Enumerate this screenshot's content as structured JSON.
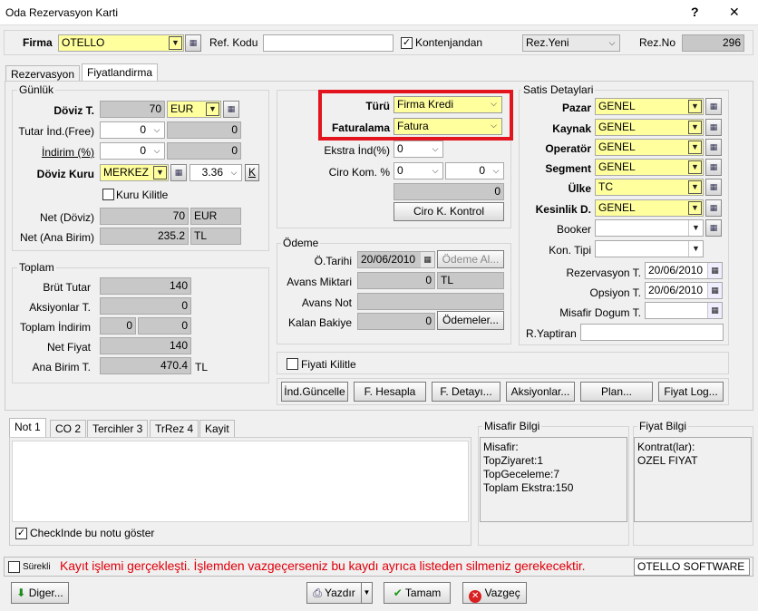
{
  "window": {
    "title": "Oda Rezervasyon Karti",
    "help": "?",
    "close": "✕"
  },
  "top": {
    "firma_label": "Firma",
    "firma_value": "OTELLO",
    "ref_label": "Ref. Kodu",
    "ref_value": "",
    "kontenjan_label": "Kontenjandan",
    "kontenjan_checked": "✓",
    "status_value": "Rez.Yeni",
    "rezno_label": "Rez.No",
    "rezno_value": "296"
  },
  "tabs": {
    "tab1": "Rezervasyon",
    "tab2": "Fiyatlandirma"
  },
  "gunluk": {
    "title": "Günlük",
    "doviz_t_label": "Döviz T.",
    "doviz_t_value": "70",
    "doviz_t_cur": "EUR",
    "tutar_label": "Tutar İnd.(Free)",
    "tutar_value": "0",
    "tutar_result": "0",
    "indirim_label": "İndirim (%)",
    "indirim_value": "0",
    "indirim_result": "0",
    "kuru_label": "Döviz Kuru",
    "kuru_source": "MERKEZ",
    "kuru_value": "3.36",
    "kuru_k": "K",
    "kilitle_label": "Kuru Kilitle",
    "net_doviz_label": "Net (Döviz)",
    "net_doviz_value": "70",
    "net_doviz_cur": "EUR",
    "net_ana_label": "Net (Ana Birim)",
    "net_ana_value": "235.2",
    "net_ana_cur": "TL"
  },
  "toplam": {
    "title": "Toplam",
    "brut_label": "Brüt Tutar",
    "brut_value": "140",
    "aksiyon_label": "Aksiyonlar T.",
    "aksiyon_value": "0",
    "indirim_label": "Toplam İndirim",
    "indirim_a": "0",
    "indirim_b": "0",
    "net_label": "Net Fiyat",
    "net_value": "140",
    "ana_label": "Ana Birim T.",
    "ana_value": "470.4",
    "ana_cur": "TL"
  },
  "turu": {
    "turu_label": "Türü",
    "turu_value": "Firma Kredi",
    "fatura_label": "Faturalama",
    "fatura_value": "Fatura",
    "ekstra_label": "Ekstra İnd(%)",
    "ekstra_value": "0",
    "ciro_label": "Ciro Kom. %",
    "ciro_a": "0",
    "ciro_b": "0",
    "ciro_total": "0",
    "kontrol_button": "Ciro K. Kontrol"
  },
  "odeme": {
    "title": "Ödeme",
    "tarih_label": "Ö.Tarihi",
    "tarih_value": "20/06/2010",
    "odeme_al_button": "Ödeme Al...",
    "avans_label": "Avans Miktari",
    "avans_value": "0",
    "avans_cur": "TL",
    "avans_not_label": "Avans Not",
    "avans_not_value": "",
    "kalan_label": "Kalan Bakiye",
    "kalan_value": "0",
    "odemeler_button": "Ödemeler..."
  },
  "satis": {
    "title": "Satis Detaylari",
    "pazar_label": "Pazar",
    "pazar_value": "GENEL",
    "kaynak_label": "Kaynak",
    "kaynak_value": "GENEL",
    "operator_label": "Operatör",
    "operator_value": "GENEL",
    "segment_label": "Segment",
    "segment_value": "GENEL",
    "ulke_label": "Ülke",
    "ulke_value": "TC",
    "kesinlik_label": "Kesinlik D.",
    "kesinlik_value": "GENEL",
    "booker_label": "Booker",
    "booker_value": "",
    "kontipi_label": "Kon. Tipi",
    "kontipi_value": "",
    "rez_t_label": "Rezervasyon T.",
    "rez_t_value": "20/06/2010",
    "opsiyon_label": "Opsiyon T.",
    "opsiyon_value": "20/06/2010",
    "dogum_label": "Misafir Dogum T.",
    "dogum_value": "",
    "yaptiran_label": "R.Yaptiran",
    "yaptiran_value": ""
  },
  "fiyat_kilitle": "Fiyati Kilitle",
  "actions": {
    "ind_guncelle": "İnd.Güncelle",
    "f_hesapla": "F. Hesapla",
    "f_detayi": "F. Detayı...",
    "aksiyonlar": "Aksiyonlar...",
    "plan": "Plan...",
    "fiyat_log": "Fiyat Log..."
  },
  "notes": {
    "tabs": [
      "Not 1",
      "CO 2",
      "Tercihler 3",
      "TrRez 4",
      "Kayit"
    ],
    "text": "",
    "checkbox_label": "CheckInde bu notu göster",
    "checkbox_mark": "✓"
  },
  "misafir": {
    "title": "Misafir Bilgi",
    "lines": [
      "Misafir:",
      "TopZiyaret:1",
      "TopGeceleme:7",
      "Toplam Ekstra:150"
    ]
  },
  "fiyatbilgi": {
    "title": "Fiyat Bilgi",
    "lines": [
      "Kontrat(lar):",
      "OZEL FIYAT"
    ]
  },
  "status": {
    "surekli_label": "Sürekli",
    "message": "Kayıt işlemi gerçekleşti. İşlemden vazgeçerseniz bu kaydı ayrıca listeden silmeniz gerekecektir.",
    "company": "OTELLO SOFTWARE"
  },
  "bottom": {
    "diger": "Diger...",
    "yazdir": "Yazdır",
    "tamam": "Tamam",
    "vazgec": "Vazgeç"
  },
  "colors": {
    "highlight_border": "#e3141e",
    "field_yellow": "#ffff9e",
    "field_gray": "#c8c8c8",
    "message_red": "#e0000b"
  }
}
